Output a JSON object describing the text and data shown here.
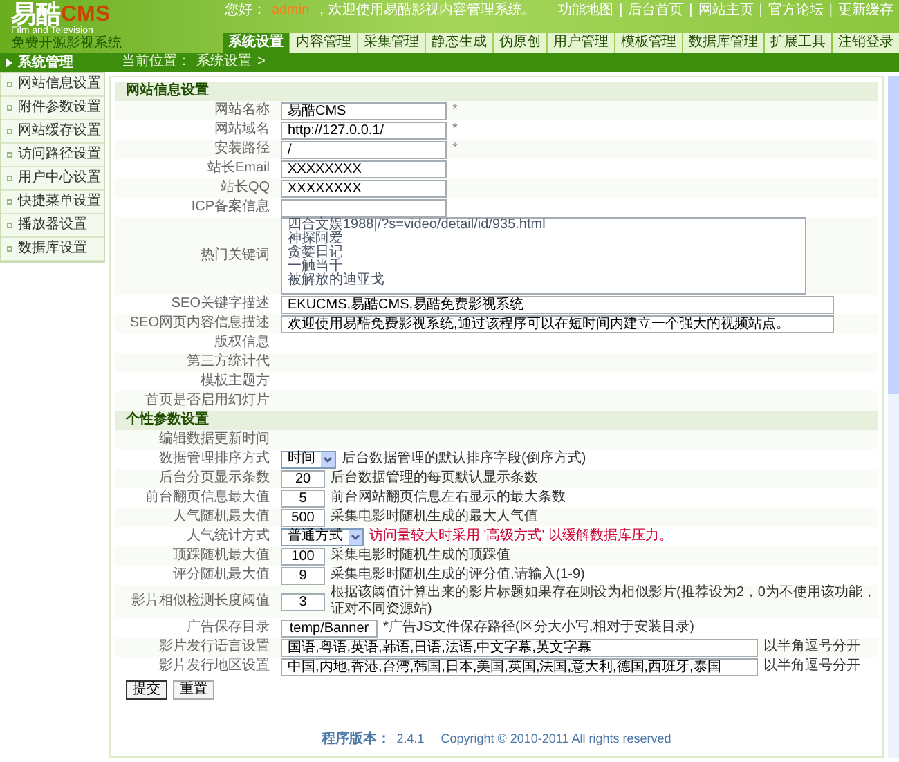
{
  "header": {
    "logo": "易酷",
    "logo_suffix": "CMS",
    "tagline_en": "Film and Television",
    "tagline": "免费开源影视系统",
    "greeting_prefix": "您好：",
    "username": "admin",
    "greeting_suffix": "，欢迎使用易酷影视内容管理系统。",
    "links": [
      "功能地图",
      "后台首页",
      "网站主页",
      "官方论坛",
      "更新缓存"
    ],
    "link_separator": "|"
  },
  "tabs": [
    {
      "label": "系统设置",
      "selected": true
    },
    {
      "label": "内容管理",
      "selected": false
    },
    {
      "label": "采集管理",
      "selected": false
    },
    {
      "label": "静态生成",
      "selected": false
    },
    {
      "label": "伪原创",
      "selected": false
    },
    {
      "label": "用户管理",
      "selected": false
    },
    {
      "label": "模板管理",
      "selected": false
    },
    {
      "label": "数据库管理",
      "selected": false
    },
    {
      "label": "扩展工具",
      "selected": false
    },
    {
      "label": "注销登录",
      "selected": false
    }
  ],
  "sidebar": {
    "title": "系统管理",
    "items": [
      "网站信息设置",
      "附件参数设置",
      "网站缓存设置",
      "访问路径设置",
      "用户中心设置",
      "快捷菜单设置",
      "播放器设置",
      "数据库设置"
    ]
  },
  "breadcrumb": {
    "label": "当前位置：",
    "current": "系统设置",
    "separator": ">"
  },
  "sections": [
    {
      "title": "网站信息设置",
      "rows": [
        {
          "label": "网站名称",
          "kind": "input",
          "value": "易酷CMS",
          "mark": "*"
        },
        {
          "label": "网站域名",
          "kind": "input",
          "value": "http://127.0.0.1/",
          "mark": "*"
        },
        {
          "label": "安装路径",
          "kind": "input",
          "value": "/",
          "mark": "*"
        },
        {
          "label": "站长Email",
          "kind": "input",
          "value": "XXXXXXXX"
        },
        {
          "label": "站长QQ",
          "kind": "input",
          "value": "XXXXXXXX"
        },
        {
          "label": "ICP备案信息",
          "kind": "input",
          "value": ""
        },
        {
          "label": "热门关键词",
          "kind": "textarea",
          "lines": [
            "四合文娱1988|/?s=video/detail/id/935.html",
            "神探阿爱",
            "贪婪日记",
            "一触当千",
            "被解放的迪亚戈"
          ]
        },
        {
          "label": "SEO关键字描述",
          "kind": "wide",
          "value": "EKUCMS,易酷CMS,易酷免费影视系统"
        },
        {
          "label": "SEO网页内容信息描述",
          "kind": "wide",
          "value": "欢迎使用易酷免费影视系统,通过该程序可以在短时间内建立一个强大的视频站点。"
        },
        {
          "label": "版权信息",
          "kind": "blank"
        },
        {
          "label": "第三方统计代",
          "kind": "blank"
        },
        {
          "label": "模板主题方",
          "kind": "blank"
        },
        {
          "label": "首页是否启用幻灯片",
          "kind": "blank"
        }
      ]
    },
    {
      "title": "个性参数设置",
      "rows": [
        {
          "label": "编辑数据更新时间",
          "kind": "blank"
        },
        {
          "label": "数据管理排序方式",
          "kind": "select",
          "value": "时间",
          "note": "后台数据管理的默认排序字段(倒序方式)"
        },
        {
          "label": "后台分页显示条数",
          "kind": "number",
          "value": "20",
          "note": "后台数据管理的每页默认显示条数"
        },
        {
          "label": "前台翻页信息最大值",
          "kind": "number",
          "value": "5",
          "note": "前台网站翻页信息左右显示的最大条数"
        },
        {
          "label": "人气随机最大值",
          "kind": "number",
          "value": "500",
          "note": "采集电影时随机生成的最大人气值"
        },
        {
          "label": "人气统计方式",
          "kind": "select",
          "value": "普通方式",
          "note": "访问量较大时采用 '高级方式' 以缓解数据库压力。",
          "warning": true
        },
        {
          "label": "顶踩随机最大值",
          "kind": "number",
          "value": "100",
          "note": "采集电影时随机生成的顶踩值"
        },
        {
          "label": "评分随机最大值",
          "kind": "number",
          "value": "9",
          "note": "采集电影时随机生成的评分值,请输入(1-9)"
        },
        {
          "label": "影片相似检测长度阈值",
          "kind": "number",
          "value": "3",
          "note": "根据该阈值计算出来的影片标题如果存在则设为相似影片(推荐设为2，0为不使用该功能，证对不同资源站)"
        },
        {
          "label": "广告保存目录",
          "kind": "path",
          "value": "temp/Banner",
          "note": "*广告JS文件保存路径(区分大小写,相对于安装目录)"
        },
        {
          "label": "影片发行语言设置",
          "kind": "list",
          "value": "国语,粤语,英语,韩语,日语,法语,中文字幕,英文字幕",
          "note": "以半角逗号分开"
        },
        {
          "label": "影片发行地区设置",
          "kind": "list",
          "value": "中国,内地,香港,台湾,韩国,日本,美国,英国,法国,意大利,德国,西班牙,泰国",
          "note": "以半角逗号分开"
        }
      ]
    }
  ],
  "buttons": [
    "提交",
    "重置"
  ],
  "footer": {
    "version_label": "程序版本：",
    "version": "2.4.1",
    "copyright": "Copyright © 2010-2011 All rights reserved"
  }
}
